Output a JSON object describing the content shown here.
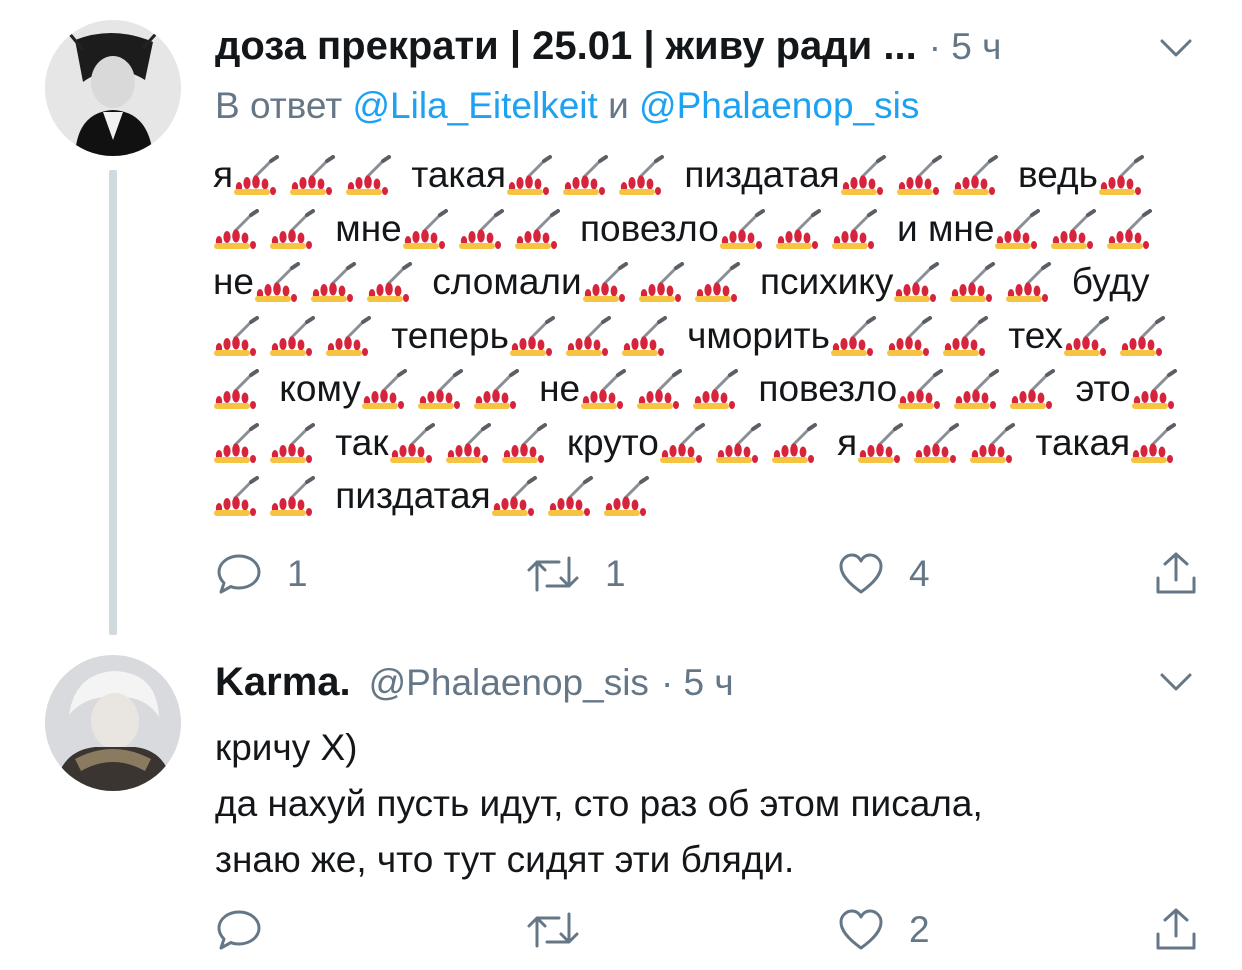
{
  "tweet1": {
    "author_name": "доза прекрати | 25.01 | живу ради ...",
    "meta": "· 5 ч",
    "reply_prefix": "В ответ",
    "reply_mention1": "@Lila_Eitelkeit",
    "reply_and": "и",
    "reply_mention2": "@Phalaenop_sis",
    "emoji_name": "nail-polish-icon",
    "text_segments": [
      {
        "word": "я",
        "emojis": 3
      },
      {
        "word": "такая",
        "emojis": 3
      },
      {
        "word": "пиздатая",
        "emojis": 3
      },
      {
        "word": "ведь",
        "emojis": 3
      },
      {
        "word": "мне",
        "emojis": 3
      },
      {
        "word": "повезло",
        "emojis": 3
      },
      {
        "word": "и мне",
        "emojis": 3
      },
      {
        "word": "не",
        "emojis": 3
      },
      {
        "word": "сломали",
        "emojis": 3
      },
      {
        "word": "психику",
        "emojis": 3
      },
      {
        "word": "буду",
        "emojis": 3
      },
      {
        "word": "теперь",
        "emojis": 3
      },
      {
        "word": "чморить",
        "emojis": 3
      },
      {
        "word": "тех",
        "emojis": 3
      },
      {
        "word": "кому",
        "emojis": 3
      },
      {
        "word": "не",
        "emojis": 3
      },
      {
        "word": "повезло",
        "emojis": 3
      },
      {
        "word": "это",
        "emojis": 3
      },
      {
        "word": "так",
        "emojis": 3
      },
      {
        "word": "круто",
        "emojis": 3
      },
      {
        "word": "я",
        "emojis": 3
      },
      {
        "word": "такая",
        "emojis": 3
      },
      {
        "word": "пиздатая",
        "emojis": 3
      }
    ],
    "actions": {
      "reply_count": "1",
      "retweet_count": "1",
      "like_count": "4"
    }
  },
  "tweet2": {
    "author_name": "Karma.",
    "handle": "@Phalaenop_sis",
    "meta": "· 5 ч",
    "text": "кричу Х)\nда нахуй пусть идут, сто раз об этом писала,\nзнаю  же, что тут сидят эти бляди.",
    "actions": {
      "like_count": "2"
    }
  },
  "colors": {
    "accent": "#1da1f2",
    "secondary_text": "#657786",
    "thread_line": "#cfd9de"
  }
}
